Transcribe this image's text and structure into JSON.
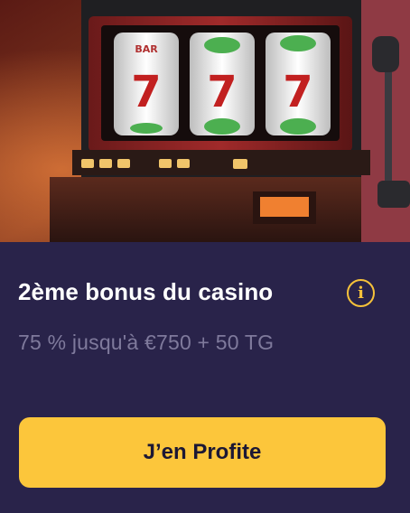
{
  "offer": {
    "title": "2ème bonus du casino",
    "subtitle": "75 % jusqu'à €750 + 50 TG",
    "cta_label": "J’en Profite"
  },
  "icons": {
    "info": "info-icon",
    "info_glyph": "i"
  },
  "hero": {
    "reel_symbol": "7",
    "reel_top_text": "BAR"
  },
  "colors": {
    "background": "#29234a",
    "accent": "#fcc63b",
    "title": "#ffffff",
    "subtitle": "#7f7a9c",
    "icon": "#f7c23a"
  }
}
